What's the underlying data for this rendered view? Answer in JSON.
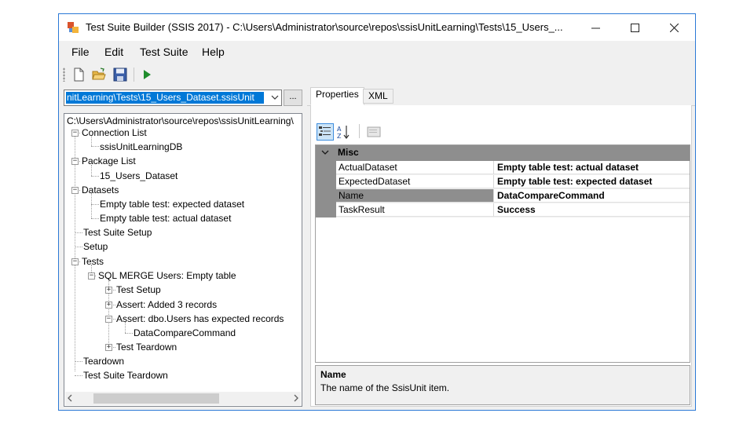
{
  "window": {
    "title": "Test Suite Builder (SSIS 2017) - C:\\Users\\Administrator\\source\\repos\\ssisUnitLearning\\Tests\\15_Users_...",
    "accent_color": "#0078d7"
  },
  "menu": [
    "File",
    "Edit",
    "Test Suite",
    "Help"
  ],
  "toolbar": {
    "icons": [
      "new-file-icon",
      "open-folder-icon",
      "save-icon",
      "run-icon"
    ]
  },
  "left": {
    "path_combo_value": "nitLearning\\Tests\\15_Users_Dataset.ssisUnit",
    "browse_label": "...",
    "tree_root": "C:\\Users\\Administrator\\source\\repos\\ssisUnitLearning\\",
    "tree": [
      "Connection List",
      "ssisUnitLearningDB",
      "Package List",
      "15_Users_Dataset",
      "Datasets",
      "Empty table test: expected dataset",
      "Empty table test: actual dataset",
      "Test Suite Setup",
      "Setup",
      "Tests",
      "SQL MERGE Users: Empty table",
      "Test Setup",
      "Assert: Added 3 records",
      "Assert: dbo.Users has expected records",
      "DataCompareCommand",
      "Test Teardown",
      "Teardown",
      "Test Suite Teardown"
    ]
  },
  "right": {
    "tabs": [
      "Properties",
      "XML"
    ],
    "active_tab": "Properties",
    "category": "Misc",
    "properties": [
      {
        "name": "ActualDataset",
        "value": "Empty table test: actual dataset"
      },
      {
        "name": "ExpectedDataset",
        "value": "Empty table test: expected dataset"
      },
      {
        "name": "Name",
        "value": "DataCompareCommand"
      },
      {
        "name": "TaskResult",
        "value": "Success"
      }
    ],
    "selected_property": "Name",
    "help_title": "Name",
    "help_description": "The name of the SsisUnit item."
  }
}
